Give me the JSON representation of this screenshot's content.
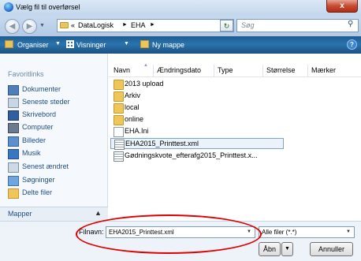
{
  "window": {
    "title": "Vælg fil til overførsel",
    "close_label": "x"
  },
  "address": {
    "prefix": "«",
    "crumbs": [
      "DataLogisk",
      "EHA"
    ],
    "separator": "►",
    "search_placeholder": "Søg"
  },
  "toolbar": {
    "organize": "Organiser",
    "views": "Visninger",
    "new_folder": "Ny mappe",
    "help": "?"
  },
  "nav": {
    "favorites_title": "Favoritlinks",
    "items": [
      "Dokumenter",
      "Seneste steder",
      "Skrivebord",
      "Computer",
      "Billeder",
      "Musik",
      "Senest ændret",
      "Søgninger",
      "Delte filer"
    ],
    "folders_label": "Mapper"
  },
  "columns": [
    "Navn",
    "Ændringsdato",
    "Type",
    "Størrelse",
    "Mærker"
  ],
  "files": [
    {
      "name": "2013 upload",
      "kind": "folder"
    },
    {
      "name": "Arkiv",
      "kind": "folder"
    },
    {
      "name": "local",
      "kind": "folder"
    },
    {
      "name": "online",
      "kind": "folder"
    },
    {
      "name": "EHA.Ini",
      "kind": "ini"
    },
    {
      "name": "EHA2015_Printtest.xml",
      "kind": "xml",
      "selected": true
    },
    {
      "name": "Gødningskvote_efterafg2015_Printtest.x...",
      "kind": "xml"
    }
  ],
  "bottom": {
    "filename_label": "Filnavn:",
    "filename_value": "EHA2015_Printtest.xml",
    "filetype_value": "Alle filer (*.*)",
    "open_label": "Åbn",
    "cancel_label": "Annuller"
  }
}
